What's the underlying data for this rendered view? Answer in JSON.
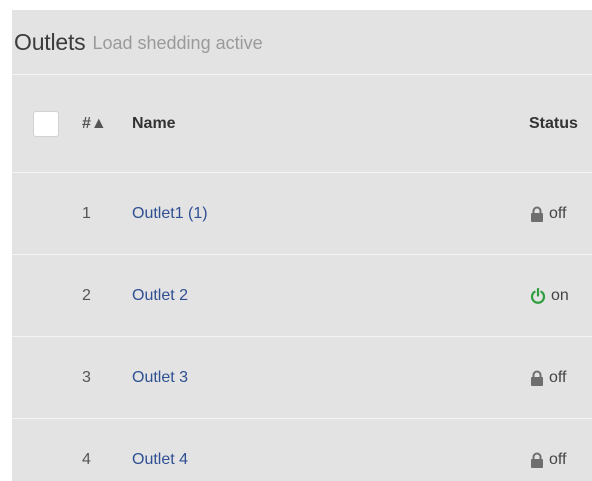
{
  "panel": {
    "title": "Outlets",
    "subtitle": "Load shedding active"
  },
  "table": {
    "columns": {
      "num": "#▲",
      "name": "Name",
      "status": "Status"
    },
    "rows": [
      {
        "num": "1",
        "name": "Outlet1 (1)",
        "status": "off",
        "icon": "lock-icon",
        "icon_color": "#6e6e6e"
      },
      {
        "num": "2",
        "name": "Outlet 2",
        "status": "on",
        "icon": "power-icon",
        "icon_color": "#2e9e3e"
      },
      {
        "num": "3",
        "name": "Outlet 3",
        "status": "off",
        "icon": "lock-icon",
        "icon_color": "#6e6e6e"
      },
      {
        "num": "4",
        "name": "Outlet 4",
        "status": "off",
        "icon": "lock-icon",
        "icon_color": "#6e6e6e"
      }
    ]
  }
}
